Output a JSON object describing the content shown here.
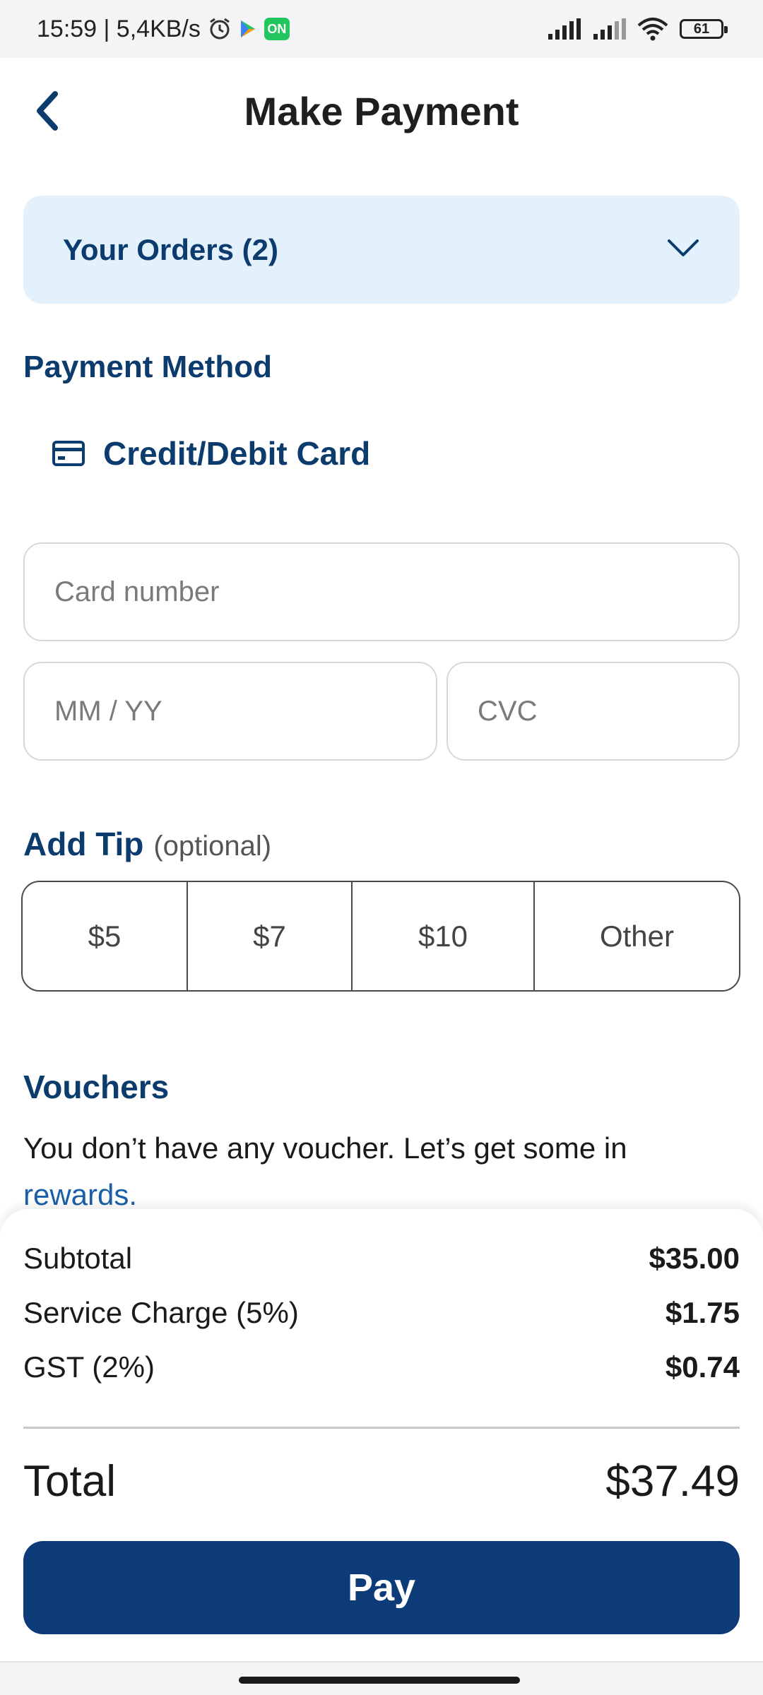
{
  "status_bar": {
    "time_speed": "15:59 | 5,4KB/s",
    "on_badge": "ON",
    "battery": "61"
  },
  "header": {
    "title": "Make Payment"
  },
  "orders": {
    "label": "Your Orders (2)"
  },
  "payment_method": {
    "title": "Payment Method",
    "selected": "Credit/Debit Card",
    "card_number_placeholder": "Card number",
    "expiry_placeholder": "MM / YY",
    "cvc_placeholder": "CVC"
  },
  "tip": {
    "title": "Add Tip",
    "optional": "(optional)",
    "options": [
      "$5",
      "$7",
      "$10",
      "Other"
    ]
  },
  "vouchers": {
    "title": "Vouchers",
    "text": "You don’t have any voucher. Let’s get some in",
    "link": "rewards."
  },
  "summary": {
    "subtotal_label": "Subtotal",
    "subtotal_value": "$35.00",
    "service_label": "Service Charge (5%)",
    "service_value": "$1.75",
    "gst_label": "GST (2%)",
    "gst_value": "$0.74",
    "total_label": "Total",
    "total_value": "$37.49",
    "pay_label": "Pay"
  },
  "colors": {
    "brand_navy": "#0c3b78",
    "accent_text": "#0c3b6e",
    "orders_bg": "#e3f1fd",
    "link": "#1a5fa8"
  }
}
